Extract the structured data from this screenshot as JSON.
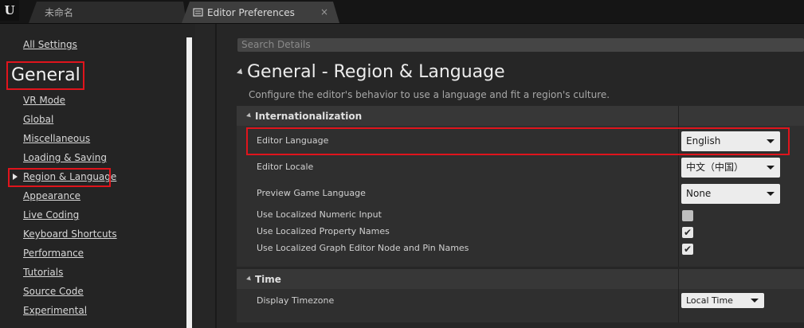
{
  "tabs": [
    {
      "label": "未命名"
    },
    {
      "label": "Editor Preferences",
      "close": "×"
    }
  ],
  "logo": "U",
  "nav": {
    "all_settings": "All Settings",
    "section_heading": "General",
    "items": [
      {
        "label": "VR Mode"
      },
      {
        "label": "Global"
      },
      {
        "label": "Miscellaneous"
      },
      {
        "label": "Loading & Saving"
      },
      {
        "label": "Region & Language"
      },
      {
        "label": "Appearance"
      },
      {
        "label": "Live Coding"
      },
      {
        "label": "Keyboard Shortcuts"
      },
      {
        "label": "Performance"
      },
      {
        "label": "Tutorials"
      },
      {
        "label": "Source Code"
      },
      {
        "label": "Experimental"
      }
    ],
    "selected_item": "Region & Language"
  },
  "details": {
    "search_placeholder": "Search Details",
    "title": "General - Region & Language",
    "subtitle": "Configure the editor's behavior to use a language and fit a region's culture.",
    "categories": [
      {
        "title": "Internationalization",
        "properties": [
          {
            "label": "Editor Language",
            "type": "combo",
            "value": "English"
          },
          {
            "label": "Editor Locale",
            "type": "combo",
            "value": "中文（中国）"
          },
          {
            "label": "Preview Game Language",
            "type": "combo",
            "value": "None"
          },
          {
            "label": "Use Localized Numeric Input",
            "type": "checkbox",
            "checked": false
          },
          {
            "label": "Use Localized Property Names",
            "type": "checkbox",
            "checked": true
          },
          {
            "label": "Use Localized Graph Editor Node and Pin Names",
            "type": "checkbox",
            "checked": true
          }
        ]
      },
      {
        "title": "Time",
        "properties": [
          {
            "label": "Display Timezone",
            "type": "combo",
            "value": "Local Time"
          }
        ]
      }
    ]
  },
  "colors": {
    "highlight": "#e0141c",
    "background": "#262626"
  },
  "check_glyph": "✔"
}
